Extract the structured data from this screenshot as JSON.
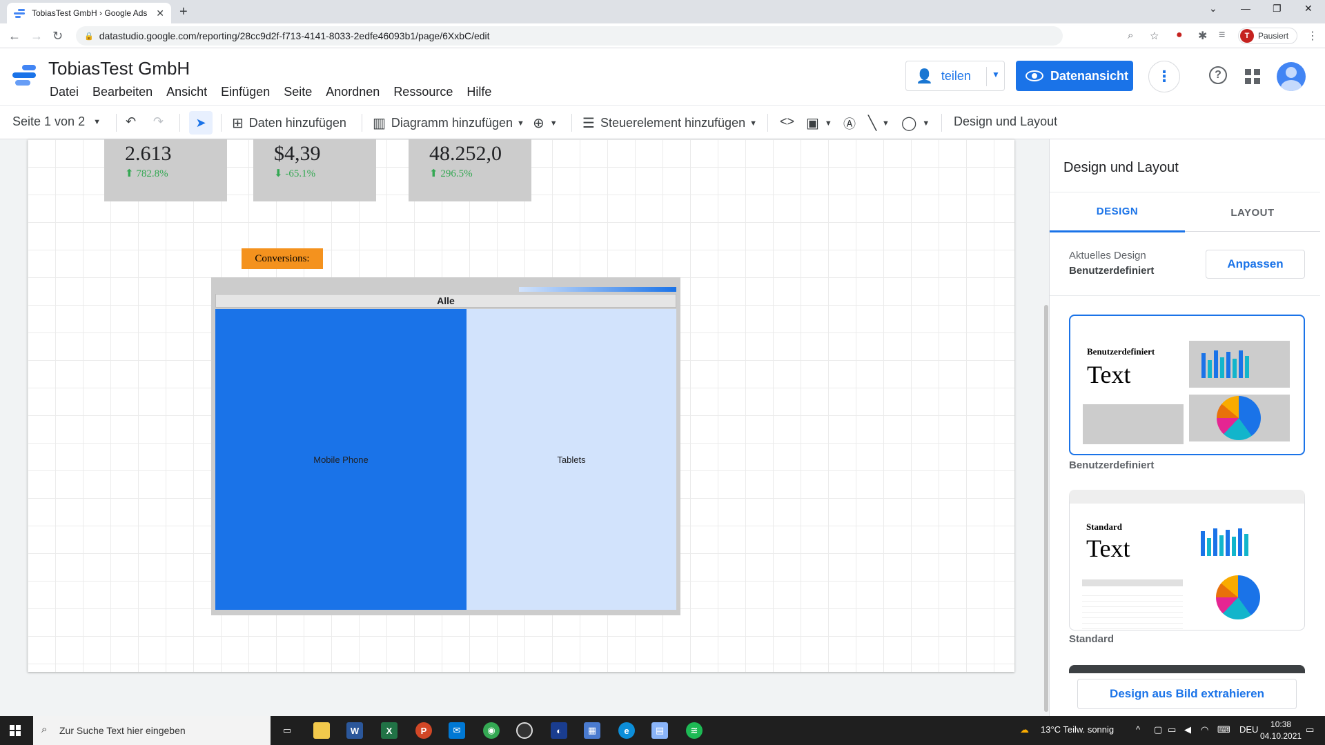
{
  "browser": {
    "tab_title": "TobiasTest GmbH › Google Ads",
    "tab_close": "✕",
    "new_tab": "+",
    "url": "datastudio.google.com/reporting/28cc9d2f-f713-4141-8033-2edfe46093b1/page/6XxbC/edit",
    "profile_initial": "T",
    "profile_status": "Pausiert"
  },
  "app": {
    "title": "TobiasTest GmbH",
    "menu": [
      "Datei",
      "Bearbeiten",
      "Ansicht",
      "Einfügen",
      "Seite",
      "Anordnen",
      "Ressource",
      "Hilfe"
    ],
    "share_label": "teilen",
    "dataview_label": "Datenansicht",
    "help_glyph": "?",
    "more_glyph": "⋮"
  },
  "toolbar": {
    "page_label": "Seite 1 von 2",
    "add_data": "Daten hinzufügen",
    "add_chart": "Diagramm hinzufügen",
    "add_control": "Steuerelement hinzufügen",
    "theme_layout": "Design und Layout"
  },
  "canvas": {
    "scorecards": [
      {
        "value": "2.613",
        "delta": "782.8%",
        "arrow": "⬆"
      },
      {
        "value": "$4,39",
        "delta": "-65.1%",
        "arrow": "⬇"
      },
      {
        "value": "48.252,0",
        "delta": "296.5%",
        "arrow": "⬆"
      }
    ],
    "conversions_label": "Conversions:",
    "treemap": {
      "header": "Alle",
      "cells": [
        "Mobile Phone",
        "Tablets"
      ]
    }
  },
  "panel": {
    "title": "Design und Layout",
    "tabs": [
      "DESIGN",
      "LAYOUT"
    ],
    "current_design_label": "Aktuelles Design",
    "current_design_value": "Benutzerdefiniert",
    "customize_button": "Anpassen",
    "themes": [
      {
        "card_name": "Benutzerdefiniert",
        "card_text": "Text",
        "label": "Benutzerdefiniert"
      },
      {
        "card_name": "Standard",
        "card_text": "Text",
        "label": "Standard"
      }
    ],
    "extract_button": "Design aus Bild extrahieren"
  },
  "taskbar": {
    "search_placeholder": "Zur Suche Text hier eingeben",
    "weather": "13°C  Teilw. sonnig",
    "lang": "DEU",
    "time": "10:38",
    "date": "04.10.2021"
  },
  "colors": {
    "accent": "#1a73e8",
    "treemap_primary": "#1a73e8",
    "treemap_secondary": "#d2e3fc",
    "conversions_bg": "#f4921e",
    "scorecard_bg": "#cccccc",
    "delta_green": "#34a853"
  }
}
